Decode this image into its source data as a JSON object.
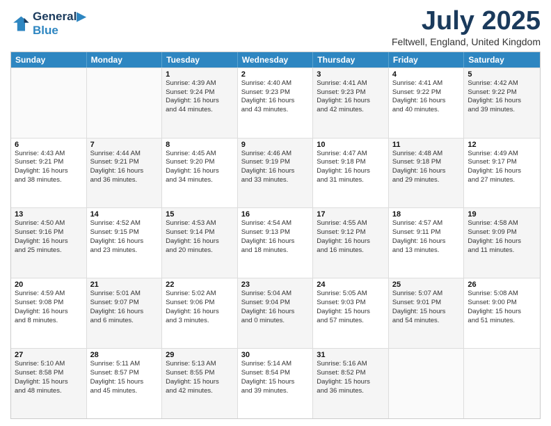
{
  "header": {
    "logo_line1": "General",
    "logo_line2": "Blue",
    "month_title": "July 2025",
    "location": "Feltwell, England, United Kingdom"
  },
  "days_of_week": [
    "Sunday",
    "Monday",
    "Tuesday",
    "Wednesday",
    "Thursday",
    "Friday",
    "Saturday"
  ],
  "weeks": [
    [
      {
        "day": "",
        "lines": [],
        "empty": true
      },
      {
        "day": "",
        "lines": [],
        "empty": true
      },
      {
        "day": "1",
        "lines": [
          "Sunrise: 4:39 AM",
          "Sunset: 9:24 PM",
          "Daylight: 16 hours",
          "and 44 minutes."
        ],
        "empty": false
      },
      {
        "day": "2",
        "lines": [
          "Sunrise: 4:40 AM",
          "Sunset: 9:23 PM",
          "Daylight: 16 hours",
          "and 43 minutes."
        ],
        "empty": false
      },
      {
        "day": "3",
        "lines": [
          "Sunrise: 4:41 AM",
          "Sunset: 9:23 PM",
          "Daylight: 16 hours",
          "and 42 minutes."
        ],
        "empty": false
      },
      {
        "day": "4",
        "lines": [
          "Sunrise: 4:41 AM",
          "Sunset: 9:22 PM",
          "Daylight: 16 hours",
          "and 40 minutes."
        ],
        "empty": false
      },
      {
        "day": "5",
        "lines": [
          "Sunrise: 4:42 AM",
          "Sunset: 9:22 PM",
          "Daylight: 16 hours",
          "and 39 minutes."
        ],
        "empty": false
      }
    ],
    [
      {
        "day": "6",
        "lines": [
          "Sunrise: 4:43 AM",
          "Sunset: 9:21 PM",
          "Daylight: 16 hours",
          "and 38 minutes."
        ],
        "empty": false
      },
      {
        "day": "7",
        "lines": [
          "Sunrise: 4:44 AM",
          "Sunset: 9:21 PM",
          "Daylight: 16 hours",
          "and 36 minutes."
        ],
        "empty": false
      },
      {
        "day": "8",
        "lines": [
          "Sunrise: 4:45 AM",
          "Sunset: 9:20 PM",
          "Daylight: 16 hours",
          "and 34 minutes."
        ],
        "empty": false
      },
      {
        "day": "9",
        "lines": [
          "Sunrise: 4:46 AM",
          "Sunset: 9:19 PM",
          "Daylight: 16 hours",
          "and 33 minutes."
        ],
        "empty": false
      },
      {
        "day": "10",
        "lines": [
          "Sunrise: 4:47 AM",
          "Sunset: 9:18 PM",
          "Daylight: 16 hours",
          "and 31 minutes."
        ],
        "empty": false
      },
      {
        "day": "11",
        "lines": [
          "Sunrise: 4:48 AM",
          "Sunset: 9:18 PM",
          "Daylight: 16 hours",
          "and 29 minutes."
        ],
        "empty": false
      },
      {
        "day": "12",
        "lines": [
          "Sunrise: 4:49 AM",
          "Sunset: 9:17 PM",
          "Daylight: 16 hours",
          "and 27 minutes."
        ],
        "empty": false
      }
    ],
    [
      {
        "day": "13",
        "lines": [
          "Sunrise: 4:50 AM",
          "Sunset: 9:16 PM",
          "Daylight: 16 hours",
          "and 25 minutes."
        ],
        "empty": false
      },
      {
        "day": "14",
        "lines": [
          "Sunrise: 4:52 AM",
          "Sunset: 9:15 PM",
          "Daylight: 16 hours",
          "and 23 minutes."
        ],
        "empty": false
      },
      {
        "day": "15",
        "lines": [
          "Sunrise: 4:53 AM",
          "Sunset: 9:14 PM",
          "Daylight: 16 hours",
          "and 20 minutes."
        ],
        "empty": false
      },
      {
        "day": "16",
        "lines": [
          "Sunrise: 4:54 AM",
          "Sunset: 9:13 PM",
          "Daylight: 16 hours",
          "and 18 minutes."
        ],
        "empty": false
      },
      {
        "day": "17",
        "lines": [
          "Sunrise: 4:55 AM",
          "Sunset: 9:12 PM",
          "Daylight: 16 hours",
          "and 16 minutes."
        ],
        "empty": false
      },
      {
        "day": "18",
        "lines": [
          "Sunrise: 4:57 AM",
          "Sunset: 9:11 PM",
          "Daylight: 16 hours",
          "and 13 minutes."
        ],
        "empty": false
      },
      {
        "day": "19",
        "lines": [
          "Sunrise: 4:58 AM",
          "Sunset: 9:09 PM",
          "Daylight: 16 hours",
          "and 11 minutes."
        ],
        "empty": false
      }
    ],
    [
      {
        "day": "20",
        "lines": [
          "Sunrise: 4:59 AM",
          "Sunset: 9:08 PM",
          "Daylight: 16 hours",
          "and 8 minutes."
        ],
        "empty": false
      },
      {
        "day": "21",
        "lines": [
          "Sunrise: 5:01 AM",
          "Sunset: 9:07 PM",
          "Daylight: 16 hours",
          "and 6 minutes."
        ],
        "empty": false
      },
      {
        "day": "22",
        "lines": [
          "Sunrise: 5:02 AM",
          "Sunset: 9:06 PM",
          "Daylight: 16 hours",
          "and 3 minutes."
        ],
        "empty": false
      },
      {
        "day": "23",
        "lines": [
          "Sunrise: 5:04 AM",
          "Sunset: 9:04 PM",
          "Daylight: 16 hours",
          "and 0 minutes."
        ],
        "empty": false
      },
      {
        "day": "24",
        "lines": [
          "Sunrise: 5:05 AM",
          "Sunset: 9:03 PM",
          "Daylight: 15 hours",
          "and 57 minutes."
        ],
        "empty": false
      },
      {
        "day": "25",
        "lines": [
          "Sunrise: 5:07 AM",
          "Sunset: 9:01 PM",
          "Daylight: 15 hours",
          "and 54 minutes."
        ],
        "empty": false
      },
      {
        "day": "26",
        "lines": [
          "Sunrise: 5:08 AM",
          "Sunset: 9:00 PM",
          "Daylight: 15 hours",
          "and 51 minutes."
        ],
        "empty": false
      }
    ],
    [
      {
        "day": "27",
        "lines": [
          "Sunrise: 5:10 AM",
          "Sunset: 8:58 PM",
          "Daylight: 15 hours",
          "and 48 minutes."
        ],
        "empty": false
      },
      {
        "day": "28",
        "lines": [
          "Sunrise: 5:11 AM",
          "Sunset: 8:57 PM",
          "Daylight: 15 hours",
          "and 45 minutes."
        ],
        "empty": false
      },
      {
        "day": "29",
        "lines": [
          "Sunrise: 5:13 AM",
          "Sunset: 8:55 PM",
          "Daylight: 15 hours",
          "and 42 minutes."
        ],
        "empty": false
      },
      {
        "day": "30",
        "lines": [
          "Sunrise: 5:14 AM",
          "Sunset: 8:54 PM",
          "Daylight: 15 hours",
          "and 39 minutes."
        ],
        "empty": false
      },
      {
        "day": "31",
        "lines": [
          "Sunrise: 5:16 AM",
          "Sunset: 8:52 PM",
          "Daylight: 15 hours",
          "and 36 minutes."
        ],
        "empty": false
      },
      {
        "day": "",
        "lines": [],
        "empty": true
      },
      {
        "day": "",
        "lines": [],
        "empty": true
      }
    ]
  ]
}
